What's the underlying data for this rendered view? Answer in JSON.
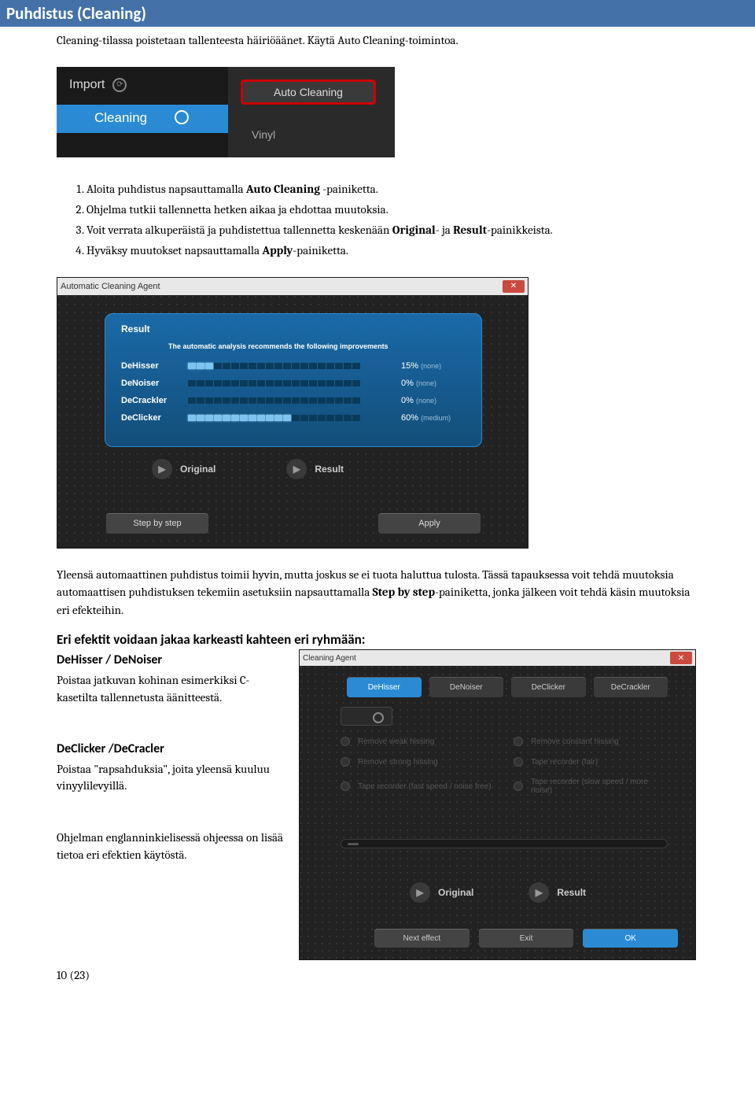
{
  "header": {
    "title": "Puhdistus (Cleaning)"
  },
  "intro": "Cleaning-tilassa poistetaan tallenteesta häiriöäänet. Käytä Auto Cleaning-toimintoa.",
  "ss1": {
    "import": "Import",
    "cleaning": "Cleaning",
    "auto_cleaning": "Auto Cleaning",
    "vinyl": "Vinyl"
  },
  "steps": {
    "s1a": "Aloita puhdistus napsauttamalla ",
    "s1b": "Auto Cleaning",
    "s1c": " -painiketta.",
    "s2": "Ohjelma tutkii tallennetta hetken aikaa ja ehdottaa muutoksia.",
    "s3a": "Voit verrata alkuperäistä ja puhdistettua tallennetta keskenään ",
    "s3b": "Original",
    "s3c": "- ja ",
    "s3d": "Result",
    "s3e": "-painikkeista.",
    "s4a": "Hyväksy muutokset napsauttamalla ",
    "s4b": "Apply",
    "s4c": "-painiketta."
  },
  "ss2": {
    "title": "Automatic Cleaning Agent",
    "result": "Result",
    "subtitle": "The automatic analysis recommends the following improvements",
    "rows": [
      {
        "label": "DeHisser",
        "filled": 3,
        "value": "15%",
        "level": "(none)"
      },
      {
        "label": "DeNoiser",
        "filled": 0,
        "value": "0%",
        "level": "(none)"
      },
      {
        "label": "DeCrackler",
        "filled": 0,
        "value": "0%",
        "level": "(none)"
      },
      {
        "label": "DeClicker",
        "filled": 12,
        "value": "60%",
        "level": "(medium)"
      }
    ],
    "original": "Original",
    "result_btn": "Result",
    "step_by_step": "Step by step",
    "apply": "Apply"
  },
  "para2a": "Yleensä automaattinen puhdistus toimii hyvin, mutta joskus se ei tuota haluttua tulosta. Tässä tapauksessa voit tehdä muutoksia automaattisen puhdistuksen tekemiin asetuksiin napsauttamalla ",
  "para2b": "Step by step",
  "para2c": "-painiketta, jonka jälkeen voit tehdä käsin muutoksia eri efekteihin.",
  "group_head": "Eri efektit voidaan jakaa karkeasti kahteen eri ryhmään:",
  "dehisser_head": "DeHisser / DeNoiser",
  "dehisser_text": "Poistaa jatkuvan kohinan esimerkiksi C-kasetilta tallennetusta äänitteestä.",
  "declicker_head": "DeClicker /DeCracler",
  "declicker_text": "Poistaa \"rapsahduksia\", joita yleensä kuuluu vinyylilevyillä.",
  "final_text": "Ohjelman englanninkielisessä ohjeessa on lisää tietoa eri efektien käytöstä.",
  "ss3": {
    "title": "Cleaning Agent",
    "tabs": [
      "DeHisser",
      "DeNoiser",
      "DeClicker",
      "DeCrackler"
    ],
    "presets": [
      "Remove weak hissing",
      "Remove constant hissing",
      "Remove strong hissing",
      "Tape recorder (fair)",
      "Tape recorder (fast speed / noise free)",
      "Tape recorder (slow speed / more noise)"
    ],
    "original": "Original",
    "result": "Result",
    "next": "Next effect",
    "exit": "Exit",
    "ok": "OK"
  },
  "page_num": "10 (23)"
}
